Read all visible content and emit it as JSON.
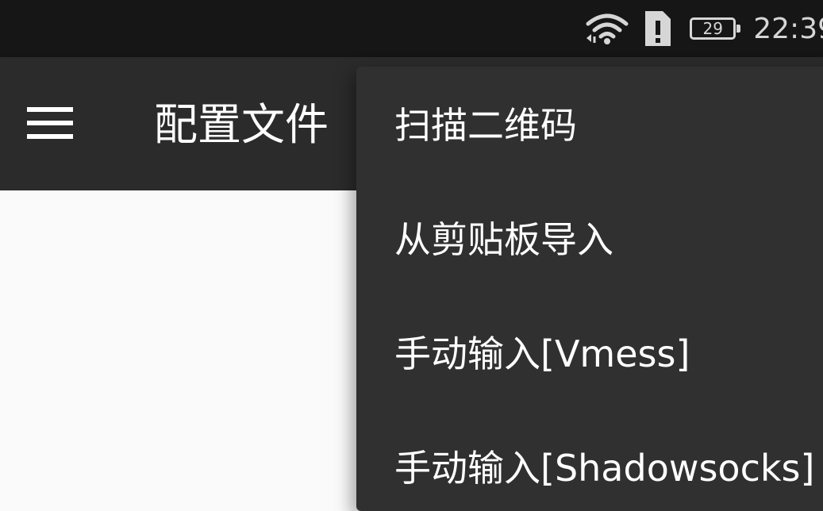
{
  "status_bar": {
    "time": "22:39",
    "battery_level": "29",
    "icons": [
      "wifi-icon",
      "sim-alert-icon",
      "battery-icon"
    ]
  },
  "app_bar": {
    "title": "配置文件",
    "menu_icon": "hamburger-menu-icon"
  },
  "overflow_menu": {
    "items": [
      {
        "label": "扫描二维码"
      },
      {
        "label": "从剪贴板导入"
      },
      {
        "label": "手动输入[Vmess]"
      },
      {
        "label": "手动输入[Shadowsocks]"
      }
    ]
  },
  "colors": {
    "status_bar_bg": "#161616",
    "app_bar_bg": "#2b2b2b",
    "menu_bg": "#303030",
    "content_bg": "#fafafa"
  }
}
